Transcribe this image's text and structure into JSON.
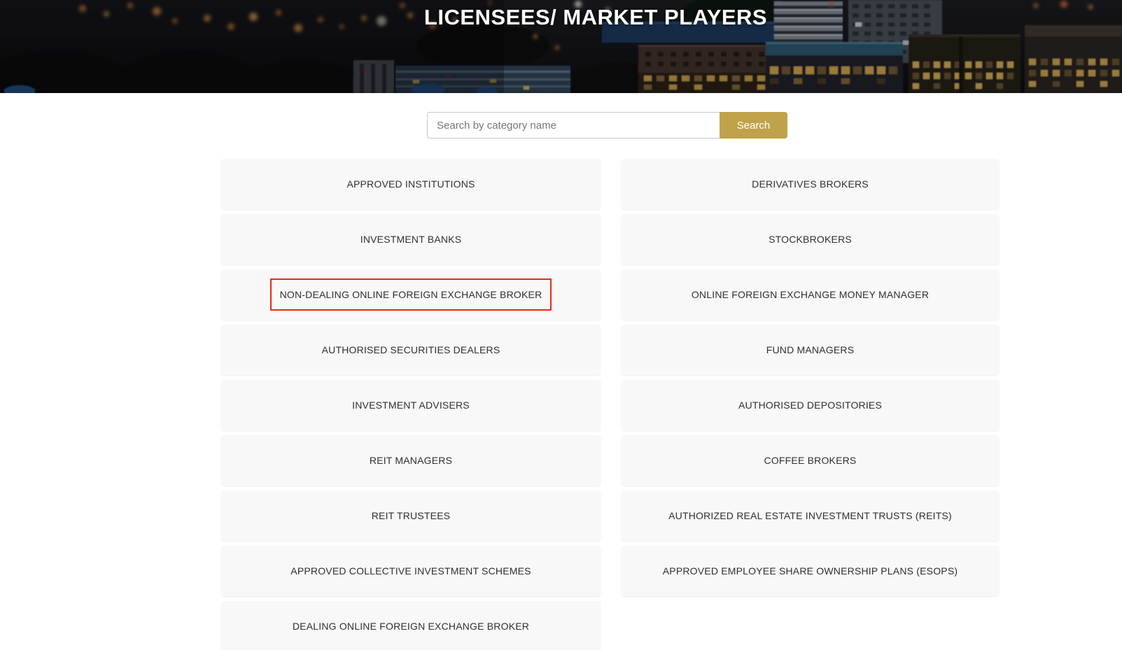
{
  "banner": {
    "title": "LICENSEES/ MARKET PLAYERS"
  },
  "search": {
    "placeholder": "Search by category name",
    "button_label": "Search"
  },
  "categories": {
    "left": [
      "APPROVED INSTITUTIONS",
      "INVESTMENT BANKS",
      "NON-DEALING ONLINE FOREIGN EXCHANGE BROKER",
      "AUTHORISED SECURITIES DEALERS",
      "INVESTMENT ADVISERS",
      "REIT MANAGERS",
      "REIT TRUSTEES",
      "APPROVED COLLECTIVE INVESTMENT SCHEMES",
      "DEALING ONLINE FOREIGN EXCHANGE BROKER"
    ],
    "right": [
      "DERIVATIVES BROKERS",
      "STOCKBROKERS",
      "ONLINE FOREIGN EXCHANGE MONEY MANAGER",
      "FUND MANAGERS",
      "AUTHORISED DEPOSITORIES",
      "COFFEE BROKERS",
      "AUTHORIZED REAL ESTATE INVESTMENT TRUSTS (REITS)",
      "APPROVED EMPLOYEE SHARE OWNERSHIP PLANS (ESOPS)"
    ]
  },
  "highlight": {
    "category": "NON-DEALING ONLINE FOREIGN EXCHANGE BROKER",
    "color": "#e8281e"
  },
  "colors": {
    "accent_gold": "#bfa24a",
    "card_bg": "#f8f8f8",
    "text": "#2f2f2f",
    "highlight_red": "#e8281e"
  }
}
